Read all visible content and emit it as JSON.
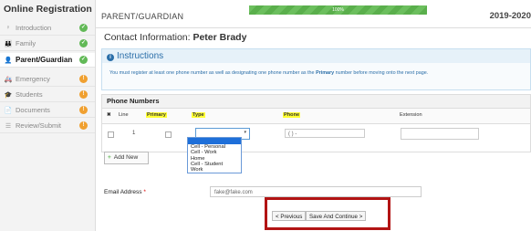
{
  "sidebar": {
    "title": "Online Registration",
    "items": [
      {
        "label": "Introduction",
        "icon": "lightbulb-icon",
        "glyph": "♀",
        "status": "ok",
        "status_glyph": "✓"
      },
      {
        "label": "Family",
        "icon": "family-icon",
        "glyph": "👪",
        "status": "ok",
        "status_glyph": "✓"
      },
      {
        "label": "Parent/Guardian",
        "icon": "user-icon",
        "glyph": "👤",
        "status": "ok",
        "status_glyph": "✓"
      },
      {
        "label": "Emergency",
        "icon": "ambulance-icon",
        "glyph": "🚑",
        "status": "warn",
        "status_glyph": "!"
      },
      {
        "label": "Students",
        "icon": "graduation-cap-icon",
        "glyph": "🎓",
        "status": "warn",
        "status_glyph": "!"
      },
      {
        "label": "Documents",
        "icon": "document-icon",
        "glyph": "📄",
        "status": "warn",
        "status_glyph": "!"
      },
      {
        "label": "Review/Submit",
        "icon": "list-icon",
        "glyph": "☰",
        "status": "warn",
        "status_glyph": "!"
      }
    ]
  },
  "header": {
    "page_title": "PARENT/GUARDIAN",
    "progress_label": "100%",
    "progress_value": 1.0,
    "year": "2019-2020"
  },
  "contact": {
    "prefix": "Contact Information: ",
    "name": "Peter Brady"
  },
  "instructions": {
    "heading": "Instructions",
    "text_before": "You must register at least one phone number as well as designating one phone number as the ",
    "text_bold": "Primary",
    "text_after": " number before moving onto the next page."
  },
  "phone_numbers": {
    "title": "Phone Numbers",
    "columns": {
      "delete": "✖",
      "line": "Line",
      "primary": "Primary",
      "type": "Type",
      "phone": "Phone",
      "extension": "Extension"
    },
    "row": {
      "line": "1",
      "phone": "(    )    -    "
    },
    "type_options": [
      "",
      "Cell - Personal",
      "Cell - Work",
      "Home",
      "Cell - Student",
      "Work"
    ],
    "add_new": "Add New"
  },
  "email": {
    "label": "Email Address",
    "required_mark": "*",
    "value": "fake@fake.com"
  },
  "buttons": {
    "previous": "< Previous",
    "save_continue": "Save And Continue >"
  },
  "colors": {
    "highlight_box": "#b21414",
    "progress": "#6cbf5e",
    "status_ok": "#62b957",
    "status_warn": "#f0a030",
    "instructions": "#2a6ea8"
  }
}
